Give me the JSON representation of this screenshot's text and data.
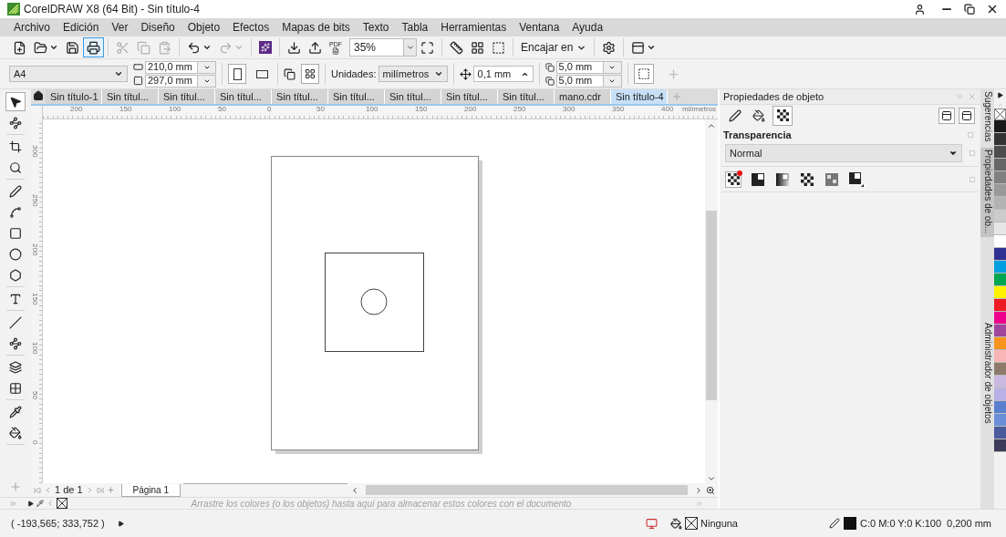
{
  "window": {
    "title": "CorelDRAW X8 (64 Bit) - Sin título-4"
  },
  "menu": [
    "Archivo",
    "Edición",
    "Ver",
    "Diseño",
    "Objeto",
    "Efectos",
    "Mapas de bits",
    "Texto",
    "Tabla",
    "Herramientas",
    "Ventana",
    "Ayuda"
  ],
  "standard_toolbar": [
    {
      "kind": "new",
      "disabled": false
    },
    {
      "kind": "open",
      "disabled": false
    },
    {
      "kind": "save",
      "disabled": false
    },
    {
      "kind": "print",
      "disabled": false,
      "highlighted": true
    },
    {
      "kind": "separator"
    },
    {
      "kind": "cut",
      "disabled": true
    },
    {
      "kind": "copy",
      "disabled": true
    },
    {
      "kind": "paste",
      "disabled": true
    },
    {
      "kind": "separator"
    },
    {
      "kind": "undo",
      "disabled": false
    },
    {
      "kind": "redo",
      "disabled": true
    },
    {
      "kind": "separator"
    },
    {
      "kind": "launcher"
    },
    {
      "kind": "separator"
    },
    {
      "kind": "import",
      "disabled": false
    },
    {
      "kind": "export",
      "disabled": false
    },
    {
      "kind": "pdf",
      "disabled": false,
      "label": "PDF"
    },
    {
      "kind": "zoom",
      "value": "35%"
    },
    {
      "kind": "fullscreen",
      "disabled": false
    },
    {
      "kind": "separator"
    },
    {
      "kind": "rulers",
      "disabled": false
    },
    {
      "kind": "grid",
      "disabled": false
    },
    {
      "kind": "guides",
      "disabled": false
    },
    {
      "kind": "separator"
    },
    {
      "kind": "snap",
      "disabled": false,
      "label": "Encajar en"
    },
    {
      "kind": "separator"
    },
    {
      "kind": "options",
      "disabled": false
    },
    {
      "kind": "separator"
    },
    {
      "kind": "window",
      "disabled": false
    }
  ],
  "property_bar": {
    "page_size": "A4",
    "width": "210,0 mm",
    "height": "297,0 mm",
    "orientation_buttons": [
      {
        "kind": "portrait",
        "selected": true
      },
      {
        "kind": "landscape",
        "selected": false
      }
    ],
    "units_label": "Unidades:",
    "units": "milímetros",
    "nudge": "0,1 mm",
    "duplicate_x": "5,0 mm",
    "duplicate_y": "5,0 mm"
  },
  "tools": [
    {
      "kind": "pick",
      "selected": true
    },
    {
      "kind": "shape",
      "selected": false
    },
    {
      "kind": "crop",
      "selected": false
    },
    {
      "kind": "zoom",
      "selected": false
    },
    {
      "kind": "freehand",
      "selected": false
    },
    {
      "kind": "artistic",
      "selected": false
    },
    {
      "kind": "rectangle",
      "selected": false
    },
    {
      "kind": "ellipse",
      "selected": false
    },
    {
      "kind": "polygon",
      "selected": false
    },
    {
      "kind": "text",
      "selected": false
    },
    {
      "kind": "dimension",
      "selected": false
    },
    {
      "kind": "connector",
      "selected": false
    },
    {
      "kind": "shadow",
      "selected": false
    },
    {
      "kind": "transparency",
      "selected": false
    },
    {
      "kind": "eyedropper",
      "selected": false
    },
    {
      "kind": "fill",
      "selected": false
    }
  ],
  "document_tabs": [
    {
      "label": "Sin título-1",
      "selected": false
    },
    {
      "label": "Sin títul...",
      "selected": false
    },
    {
      "label": "Sin títul...",
      "selected": false
    },
    {
      "label": "Sin títul...",
      "selected": false
    },
    {
      "label": "Sin títul...",
      "selected": false
    },
    {
      "label": "Sin títul...",
      "selected": false
    },
    {
      "label": "Sin títul...",
      "selected": false
    },
    {
      "label": "Sin títul...",
      "selected": false
    },
    {
      "label": "Sin títul...",
      "selected": false
    },
    {
      "label": "mano.cdr",
      "selected": false
    },
    {
      "label": "Sin título-4",
      "selected": true
    }
  ],
  "ruler": {
    "h_labels": [
      "200",
      "150",
      "100",
      "50",
      "0",
      "50",
      "100",
      "150",
      "200",
      "250",
      "300",
      "350",
      "400"
    ],
    "unit": "milímetros",
    "v_labels": [
      "300",
      "250",
      "200",
      "150",
      "100",
      "50",
      "0"
    ]
  },
  "page_nav": {
    "current": "1",
    "of": "de",
    "total": "1",
    "page_tab": "Página 1"
  },
  "document_palette": {
    "hint": "Arrastre los colores (o los objetos) hasta aquí para almacenar estos colores con el documento"
  },
  "docker": {
    "title": "Propiedades de objeto",
    "tabs": [
      {
        "kind": "outline",
        "selected": false
      },
      {
        "kind": "fill",
        "selected": false
      },
      {
        "kind": "transparency",
        "selected": true
      }
    ],
    "section": "Transparencia",
    "mode": "Normal",
    "types": [
      {
        "kind": "none",
        "selected": true
      },
      {
        "kind": "uniform",
        "selected": false
      },
      {
        "kind": "fountain",
        "selected": false
      },
      {
        "kind": "vector",
        "selected": false
      },
      {
        "kind": "bitmap",
        "selected": false
      },
      {
        "kind": "two-color",
        "selected": false
      }
    ]
  },
  "side_tabs": [
    {
      "label": "Sugerencias",
      "selected": false
    },
    {
      "label": "Propiedades de ob...",
      "selected": true
    },
    {
      "label": "Administrador de objetos",
      "selected": false
    }
  ],
  "palette": [
    {
      "color": "#1a1a1a"
    },
    {
      "color": "#333333"
    },
    {
      "color": "#4d4d4d"
    },
    {
      "color": "#666666"
    },
    {
      "color": "#808080"
    },
    {
      "color": "#999999"
    },
    {
      "color": "#b3b3b3"
    },
    {
      "color": "#cccccc"
    },
    {
      "color": "#e6e6e6"
    },
    {
      "color": "#ffffff"
    },
    {
      "color": "#2e3192"
    },
    {
      "color": "#00a0e0"
    },
    {
      "color": "#00a651"
    },
    {
      "color": "#fff200"
    },
    {
      "color": "#ed1c24"
    },
    {
      "color": "#ec008c"
    },
    {
      "color": "#a0449c"
    },
    {
      "color": "#f7941d"
    },
    {
      "color": "#f7b5b5"
    },
    {
      "color": "#8c7b6b"
    },
    {
      "color": "#c9b8e0"
    },
    {
      "color": "#b8b0e6"
    },
    {
      "color": "#5b7fcf"
    },
    {
      "color": "#6a8fd8"
    },
    {
      "color": "#4a5a9a"
    },
    {
      "color": "#3c3c5a"
    }
  ],
  "status_bar": {
    "coordinates": "( -193,565; 333,752 )",
    "fill": "Ninguna",
    "outline_color": "C:0 M:0 Y:0 K:100",
    "outline_width": "0,200 mm"
  }
}
